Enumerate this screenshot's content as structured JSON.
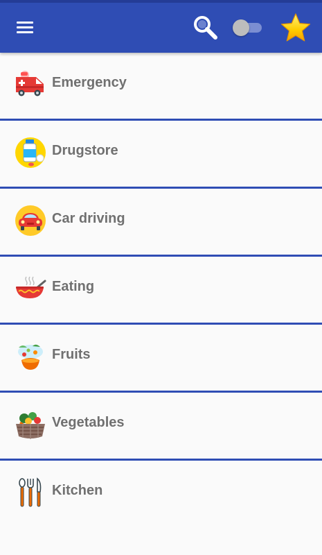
{
  "header": {
    "menu_icon": "hamburger-menu-icon",
    "search_icon": "search-icon",
    "toggle_state": "off",
    "star_icon": "star-icon"
  },
  "categories": [
    {
      "label": "Emergency",
      "icon": "ambulance-icon"
    },
    {
      "label": "Drugstore",
      "icon": "medicine-bottle-icon"
    },
    {
      "label": "Car driving",
      "icon": "car-icon"
    },
    {
      "label": "Eating",
      "icon": "soup-bowl-icon"
    },
    {
      "label": "Fruits",
      "icon": "fruits-icon"
    },
    {
      "label": "Vegetables",
      "icon": "vegetable-basket-icon"
    },
    {
      "label": "Kitchen",
      "icon": "cutlery-icon"
    }
  ],
  "colors": {
    "app_bar": "#2f4db4",
    "divider": "#2f4db4",
    "label_text": "#707070",
    "background": "#fafafa"
  }
}
